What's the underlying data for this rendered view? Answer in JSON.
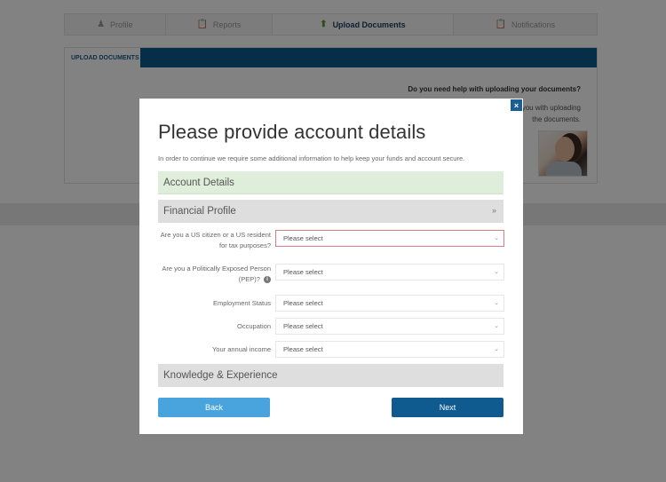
{
  "tabs": [
    {
      "label": "Profile",
      "icon": "user-icon",
      "active": false
    },
    {
      "label": "Reports",
      "icon": "clipboard-icon",
      "active": false
    },
    {
      "label": "Upload Documents",
      "icon": "upload-icon",
      "active": true
    },
    {
      "label": "Notifications",
      "icon": "clipboard-icon",
      "active": false
    }
  ],
  "upload_panel": {
    "tab_label": "UPLOAD DOCUMENTS",
    "help_title": "Do you need help with uploading your documents?",
    "help_text": "Our team is standing by to help you with uploading the documents."
  },
  "modal": {
    "close_label": "×",
    "title": "Please provide account details",
    "subtitle": "In order to continue we require some additional information to help keep your funds and account secure.",
    "sections": {
      "account_details": "Account Details",
      "financial_profile": "Financial Profile",
      "knowledge_experience": "Knowledge & Experience"
    },
    "fields": [
      {
        "label": "Are you a US citizen or a US resident for tax purposes?",
        "value": "Please select",
        "error": true
      },
      {
        "label": "Are you a Politically Exposed Person (PEP)?",
        "value": "Please select",
        "info": true
      },
      {
        "label": "Employment Status",
        "value": "Please select"
      },
      {
        "label": "Occupation",
        "value": "Please select"
      },
      {
        "label": "Your annual income",
        "value": "Please select"
      }
    ],
    "back_label": "Back",
    "next_label": "Next"
  },
  "colors": {
    "primary": "#0f5a8f",
    "secondary": "#49a3dd",
    "completed_section": "#dfeedb",
    "error_border": "#d57e83"
  }
}
